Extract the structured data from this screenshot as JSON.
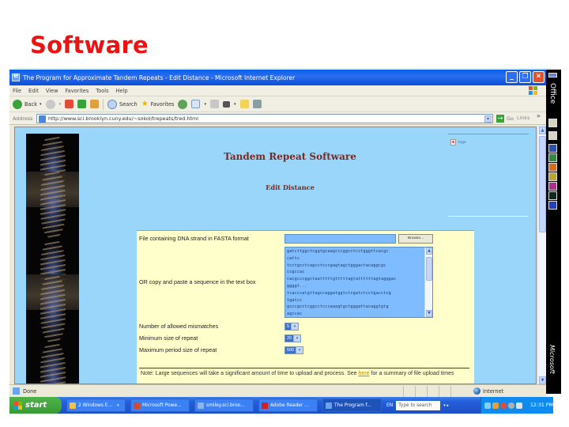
{
  "slide": {
    "title": "Software"
  },
  "browser": {
    "window_title": "The Program for Approximate Tandem Repeats - Edit Distance - Microsoft Internet Explorer",
    "window_buttons": {
      "minimize": "_",
      "restore": "❐",
      "close": "✕"
    },
    "menu": [
      "File",
      "Edit",
      "View",
      "Favorites",
      "Tools",
      "Help"
    ],
    "toolbar": {
      "back": "Back",
      "search": "Search",
      "favorites": "Favorites"
    },
    "address": {
      "label": "Address",
      "url": "http://www.sci.brooklyn.cuny.edu/~sokol/trepeats/tred.html",
      "go": "Go",
      "links": "Links",
      "links_more": "»"
    },
    "status": {
      "text": "Done",
      "zone": "Internet"
    }
  },
  "page": {
    "heading": "Tandem Repeat Software",
    "subheading": "Edit Distance",
    "pdf_link": "logo",
    "form": {
      "file_label": "File containing DNA strand in FASTA format",
      "browse_label": "Browse...",
      "paste_label": "OR copy and paste a sequence in the text box",
      "sequence_lines": [
        "gatcttggctcggtgcaagcccggcctcctgggttcacgc",
        "cattc",
        "tcctgcctcagcctcccgagtagctgggactacaggcgc",
        "ccgccac",
        "cacgcccggctaatttttgtttttagtattttttagtagggac",
        "ggggt...",
        "tcacccatgttagccaggatggtctcgatctcctgacctcg",
        "tgatcc",
        "gcccgcctcggcctcccaaagtgctgggattacaggtgtg",
        "agccac"
      ],
      "mismatches": {
        "label": "Number of allowed mismatches",
        "value": "5"
      },
      "min_size": {
        "label": "Minimum size of repeat",
        "value": "20"
      },
      "max_period": {
        "label": "Maximum period size of repeat",
        "value": "500"
      },
      "note_prefix": "Note: Large sequences will take a significant amount of time to upload and process.  See ",
      "note_link": "here",
      "note_suffix": " for a summary of file upload times"
    }
  },
  "taskbar": {
    "start": "start",
    "tasks": [
      {
        "label": "2 Windows E...",
        "color": "#f3c24a"
      },
      {
        "label": "Microsoft Powe...",
        "color": "#d9482b"
      },
      {
        "label": "smiley.sci.broo...",
        "color": "#8fb4e8"
      },
      {
        "label": "Adobe Reader ...",
        "color": "#d42020"
      },
      {
        "label": "The Program f...",
        "color": "#6aa3f0"
      }
    ],
    "language": "EN",
    "search_placeholder": "Type to search",
    "clock": "12:31 PM"
  },
  "office_bar": {
    "label": "Office",
    "brand": "Microsoft"
  }
}
